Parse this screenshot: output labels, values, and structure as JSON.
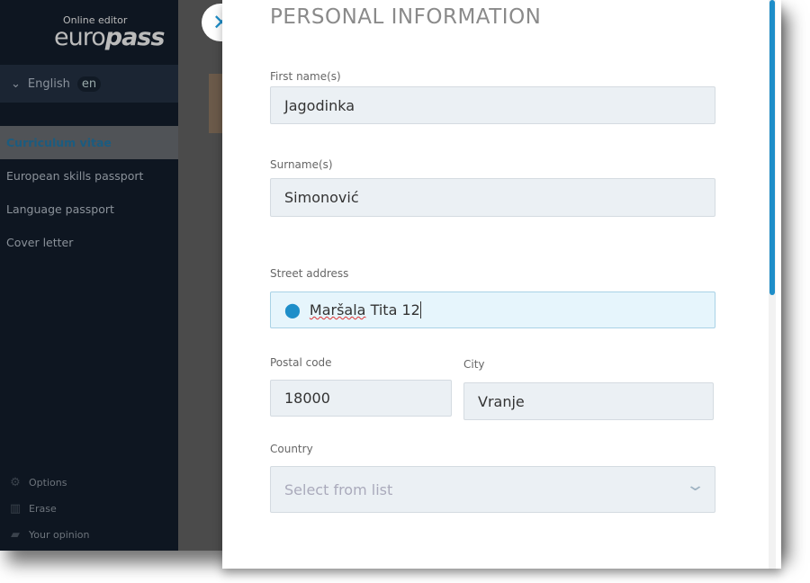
{
  "sidebar": {
    "logo": {
      "subtitle": "Online editor",
      "brand_a": "euro",
      "brand_b": "pass"
    },
    "language": {
      "label": "English",
      "code": "en"
    },
    "nav": [
      {
        "label": "Curriculum vitae",
        "active": true
      },
      {
        "label": "European skills passport"
      },
      {
        "label": "Language passport"
      },
      {
        "label": "Cover letter"
      }
    ],
    "bottom": [
      {
        "icon": "gear-icon",
        "label": "Options"
      },
      {
        "icon": "trash-icon",
        "label": "Erase"
      },
      {
        "icon": "speech-bubble-icon",
        "label": "Your opinion"
      }
    ]
  },
  "modal": {
    "title": "PERSONAL INFORMATION",
    "fields": {
      "first_name": {
        "label": "First name(s)",
        "value": "Jagodinka"
      },
      "surname": {
        "label": "Surname(s)",
        "value": "Simonović"
      },
      "street": {
        "label": "Street address",
        "value_a": "Maršala",
        "value_b": " Tita 12"
      },
      "postal": {
        "label": "Postal code",
        "value": "18000"
      },
      "city": {
        "label": "City",
        "value": "Vranje"
      },
      "country": {
        "label": "Country",
        "placeholder": "Select from list"
      }
    }
  },
  "colors": {
    "accent": "#1e8ec9",
    "sidebar": "#0e1621"
  }
}
